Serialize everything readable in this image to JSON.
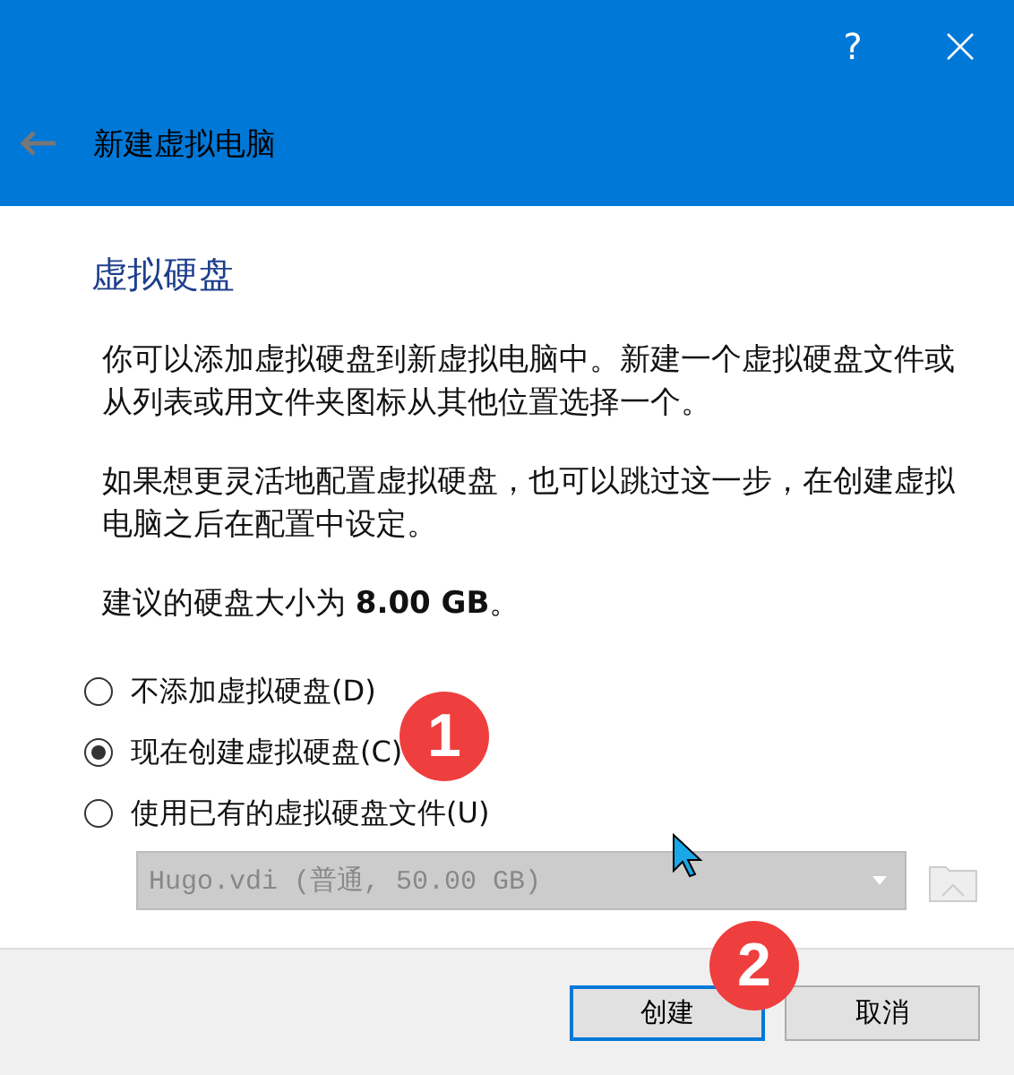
{
  "window": {
    "help": "?",
    "title": "新建虚拟电脑"
  },
  "heading": "虚拟硬盘",
  "paragraphs": [
    "你可以添加虚拟硬盘到新虚拟电脑中。新建一个虚拟硬盘文件或从列表或用文件夹图标从其他位置选择一个。",
    "如果想更灵活地配置虚拟硬盘，也可以跳过这一步，在创建虚拟电脑之后在配置中设定。",
    "建议的硬盘大小为 **8.00 GB**。"
  ],
  "options": [
    {
      "label": "不添加虚拟硬盘(D)",
      "selected": false
    },
    {
      "label": "现在创建虚拟硬盘(C)",
      "selected": true
    },
    {
      "label": "使用已有的虚拟硬盘文件(U)",
      "selected": false
    }
  ],
  "file_select": {
    "value": "Hugo.vdi (普通, 50.00 GB)",
    "disabled": true
  },
  "buttons": [
    {
      "label": "创建",
      "default": true
    },
    {
      "label": "取消",
      "default": false
    }
  ],
  "annotations": [
    "1",
    "2"
  ]
}
